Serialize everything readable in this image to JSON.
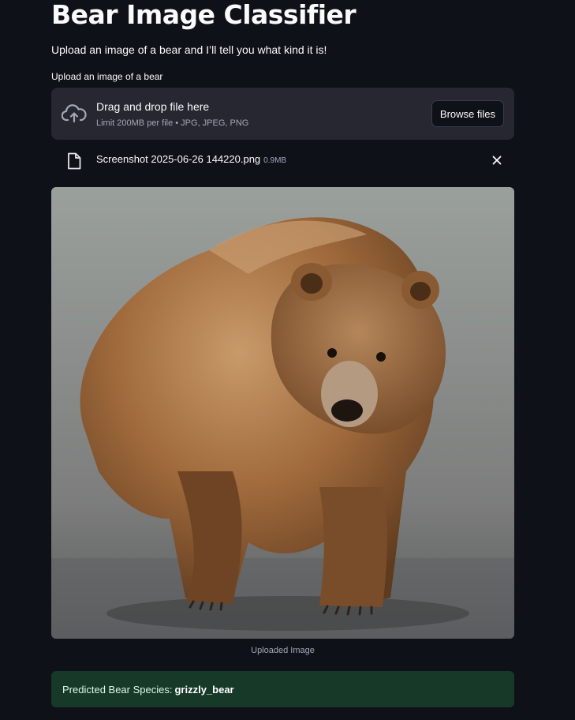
{
  "header": {
    "title": "Bear Image Classifier",
    "subtitle": "Upload an image of a bear and I’ll tell you what kind it is!"
  },
  "uploader": {
    "label": "Upload an image of a bear",
    "drop_title": "Drag and drop file here",
    "drop_limit": "Limit 200MB per file • JPG, JPEG, PNG",
    "browse_label": "Browse files",
    "upload_icon": "cloud-upload-icon"
  },
  "file": {
    "name": "Screenshot 2025-06-26 144220.png",
    "size": "0.9MB",
    "file_icon": "file-icon",
    "remove_icon": "close-icon"
  },
  "image": {
    "caption": "Uploaded Image"
  },
  "result": {
    "prefix": "Predicted Bear Species:",
    "species": "grizzly_bear"
  },
  "colors": {
    "background": "#0e1117",
    "panel": "#262730",
    "success_bg": "#173928",
    "muted_text": "#a3a8b8"
  }
}
